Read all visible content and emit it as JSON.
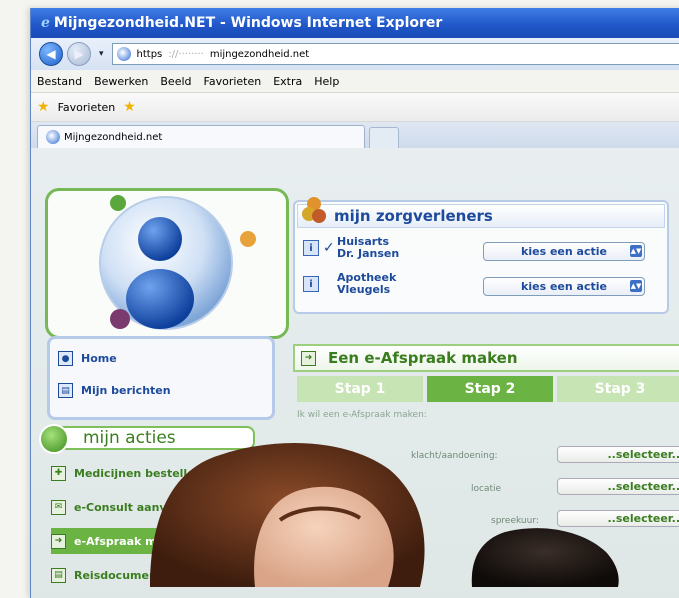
{
  "window": {
    "title": "Mijngezondheid.NET - Windows Internet Explorer",
    "ie_glyph": "e"
  },
  "address": {
    "scheme": "https",
    "mask": "://········",
    "host": "mijngezondheid.net"
  },
  "menu": [
    "Bestand",
    "Bewerken",
    "Beeld",
    "Favorieten",
    "Extra",
    "Help"
  ],
  "favorites": {
    "label": "Favorieten"
  },
  "tab": {
    "label": "Mijngezondheid.net"
  },
  "zorg": {
    "title": "mijn zorgverleners",
    "rows": [
      {
        "line1": "Huisarts",
        "line2": "Dr. Jansen",
        "action": "kies een actie",
        "checked": true
      },
      {
        "line1": "Apotheek",
        "line2": "Vleugels",
        "action": "kies een actie",
        "checked": false
      }
    ]
  },
  "nav": {
    "items": [
      "Home",
      "Mijn berichten"
    ]
  },
  "acties": {
    "title": "mijn acties",
    "items": [
      "Medicijnen bestellen",
      "e-Consult aanvragen",
      "e-Afspraak maken",
      "Reisdocumenten"
    ]
  },
  "afspraak": {
    "title": "Een e-Afspraak maken",
    "steps": [
      "Stap 1",
      "Stap 2",
      "Stap 3"
    ],
    "active_step": 2,
    "intro": "Ik wil een e-Afspraak maken:",
    "fields": [
      {
        "label": "klacht/aandoening:",
        "button": "..selecteer.."
      },
      {
        "label": "locatie",
        "button": "..selecteer.."
      },
      {
        "label": "spreekuur:",
        "button": "..selecteer.."
      }
    ]
  },
  "icons": {
    "info": "i",
    "check": "✓",
    "home": "person-icon",
    "messages": "mail-icon",
    "dropdown": "▾",
    "back": "◀",
    "forward": "▶"
  },
  "colors": {
    "brand_blue": "#1d4a9b",
    "brand_green": "#3a7d1f",
    "accent_green": "#6bb342",
    "titlebar": "#1f55c7"
  }
}
